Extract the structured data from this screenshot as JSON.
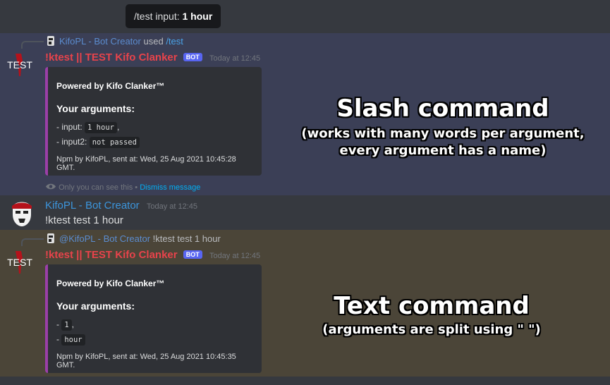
{
  "tooltip": {
    "prefix": "/test input:",
    "value": "1 hour"
  },
  "slash_message": {
    "reply": {
      "user": "KifoPL - Bot Creator",
      "used": "used",
      "command": "/test"
    },
    "avatar_text": "TEST",
    "author": "!ktest || TEST Kifo Clanker",
    "badge": "BOT",
    "timestamp": "Today at 12:45",
    "embed": {
      "powered": "Powered by Kifo Clanker™",
      "args_title": "Your arguments:",
      "arg1_label": "- input: ",
      "arg1_value": "1 hour",
      "arg1_suffix": ",",
      "arg2_label": "- input2: ",
      "arg2_value": "not passed",
      "footer": "Npm by KifoPL, sent at: Wed, 25 Aug 2021 10:45:28 GMT."
    },
    "ephemeral": {
      "text": "Only you can see this •",
      "dismiss": "Dismiss message"
    }
  },
  "user_message": {
    "author": "KifoPL - Bot Creator",
    "timestamp": "Today at 12:45",
    "text": "!ktest test 1 hour"
  },
  "text_message": {
    "reply": {
      "user": "@KifoPL - Bot Creator",
      "content": "!ktest test 1 hour"
    },
    "avatar_text": "TEST",
    "author": "!ktest || TEST Kifo Clanker",
    "badge": "BOT",
    "timestamp": "Today at 12:45",
    "embed": {
      "powered": "Powered by Kifo Clanker™",
      "args_title": "Your arguments:",
      "arg1_label": "- ",
      "arg1_value": "1",
      "arg1_suffix": ",",
      "arg2_label": "- ",
      "arg2_value": "hour",
      "footer": "Npm by KifoPL, sent at: Wed, 25 Aug 2021 10:45:35 GMT."
    }
  },
  "annotations": {
    "slash_title": "Slash command",
    "slash_sub1": "(works with many words per argument,",
    "slash_sub2": "every argument has a name)",
    "text_title": "Text command",
    "text_sub": "(arguments are split using \" \")"
  }
}
